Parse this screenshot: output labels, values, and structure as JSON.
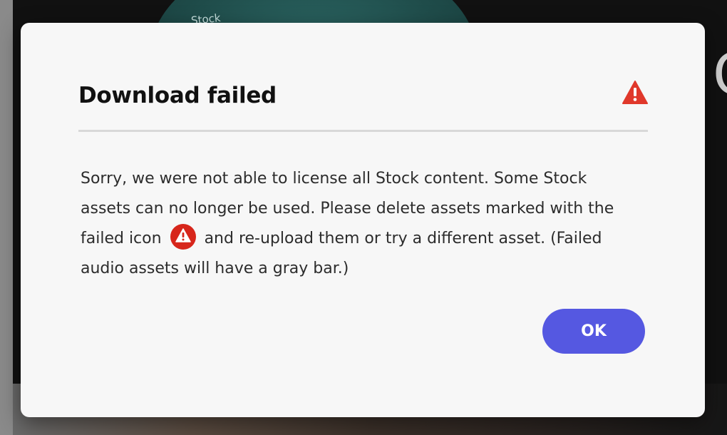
{
  "background": {
    "stock_text": "Stock",
    "edge_letter": "C"
  },
  "dialog": {
    "title": "Download failed",
    "title_icon": "alert-triangle-icon",
    "message_part1": "Sorry, we were not able to license all Stock content. Some Stock assets can no longer be used. Please delete assets marked with the failed icon",
    "inline_icon": "failed-alert-circle-icon",
    "message_part2": "and re-upload them or try a different asset. (Failed audio assets will have a gray bar.)",
    "ok_label": "OK"
  },
  "colors": {
    "alert_red": "#e0382b",
    "failed_icon_red": "#d7261b",
    "primary_button": "#5558e1",
    "dialog_background": "#f7f7f7"
  }
}
